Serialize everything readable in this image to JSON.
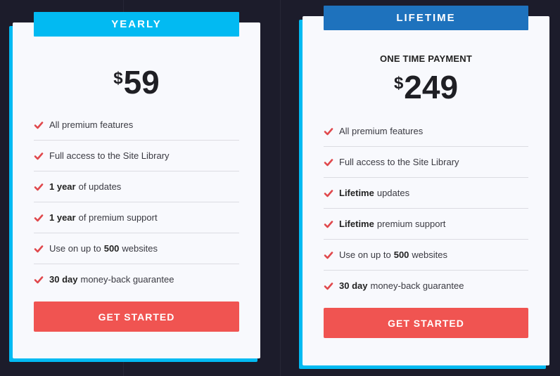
{
  "colors": {
    "background": "#1c1c2b",
    "card": "#f8f9fd",
    "shadow_accent": "#02baf2",
    "yearly_badge": "#02baf2",
    "lifetime_badge": "#1e72bd",
    "button": "#f05451",
    "check": "#e0484c"
  },
  "plans": [
    {
      "badge": "YEARLY",
      "subtitle": "",
      "currency": "$",
      "price": "59",
      "features": [
        {
          "bold": "",
          "text": "All premium features"
        },
        {
          "bold": "",
          "text": "Full access to the Site Library"
        },
        {
          "bold": "1 year",
          "text": "of updates"
        },
        {
          "bold": "1 year",
          "text": "of premium support"
        },
        {
          "pre": "Use on up to",
          "bold": "500",
          "text": "websites"
        },
        {
          "bold": "30 day",
          "text": "money-back guarantee"
        }
      ],
      "button": "GET STARTED"
    },
    {
      "badge": "LIFETIME",
      "subtitle": "ONE TIME PAYMENT",
      "currency": "$",
      "price": "249",
      "features": [
        {
          "bold": "",
          "text": "All premium features"
        },
        {
          "bold": "",
          "text": "Full access to the Site Library"
        },
        {
          "bold": "Lifetime",
          "text": "updates"
        },
        {
          "bold": "Lifetime",
          "text": "premium support"
        },
        {
          "pre": "Use on up to",
          "bold": "500",
          "text": "websites"
        },
        {
          "bold": "30 day",
          "text": "money-back guarantee"
        }
      ],
      "button": "GET STARTED"
    }
  ]
}
